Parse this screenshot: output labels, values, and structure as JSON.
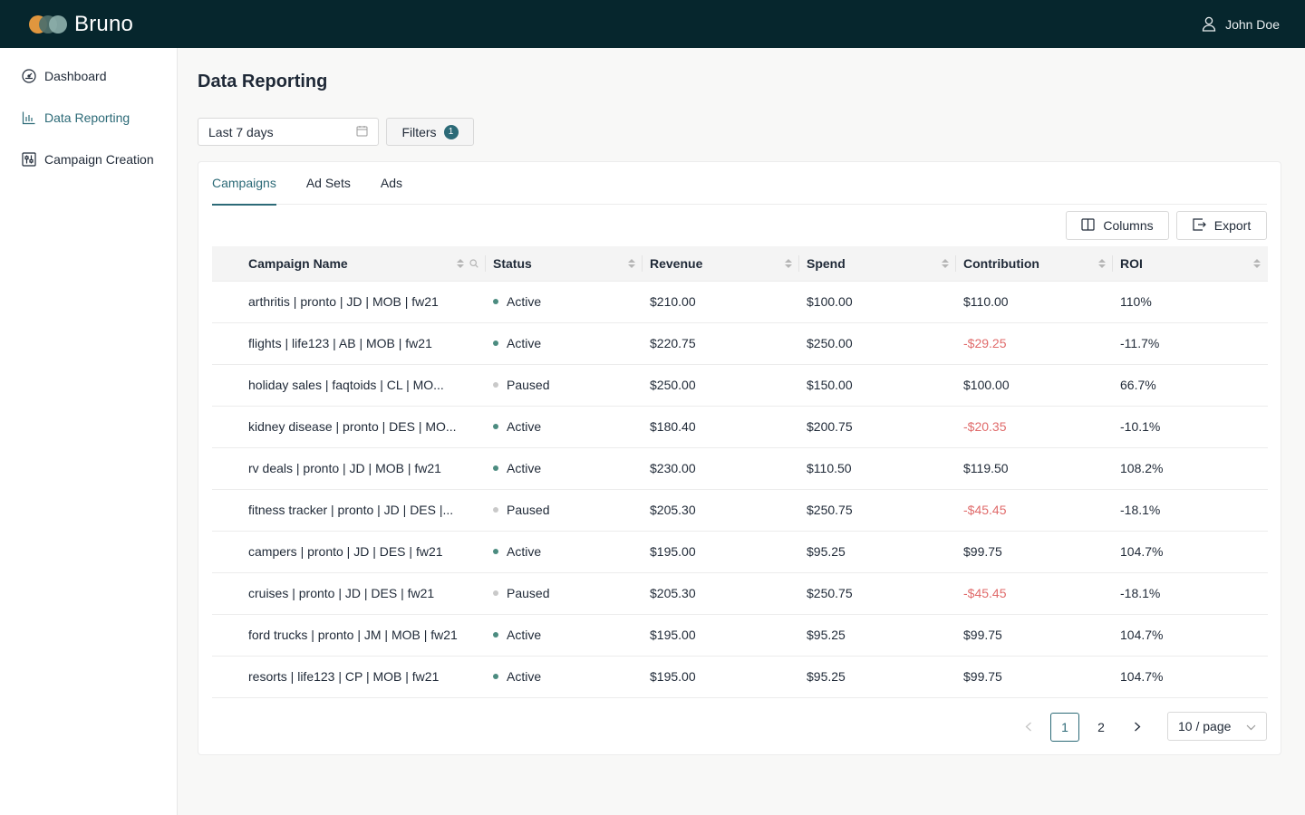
{
  "app": {
    "brand": "Bruno",
    "user_name": "John Doe"
  },
  "sidebar": {
    "items": [
      {
        "label": "Dashboard",
        "icon": "gauge-icon"
      },
      {
        "label": "Data Reporting",
        "icon": "bar-chart-icon",
        "active": true
      },
      {
        "label": "Campaign Creation",
        "icon": "sliders-icon"
      }
    ]
  },
  "page": {
    "title": "Data Reporting"
  },
  "toolbar": {
    "date_range": "Last 7 days",
    "filters_label": "Filters",
    "filters_count": "1",
    "columns_label": "Columns",
    "export_label": "Export"
  },
  "tabs": [
    {
      "label": "Campaigns",
      "active": true
    },
    {
      "label": "Ad Sets"
    },
    {
      "label": "Ads"
    }
  ],
  "table": {
    "headers": [
      "Campaign Name",
      "Status",
      "Revenue",
      "Spend",
      "Contribution",
      "ROI"
    ],
    "rows": [
      {
        "name": "arthritis | pronto | JD | MOB | fw21",
        "status": "Active",
        "revenue": "$210.00",
        "spend": "$100.00",
        "contribution": "$110.00",
        "roi": "110%"
      },
      {
        "name": "flights | life123 | AB | MOB | fw21",
        "status": "Active",
        "revenue": "$220.75",
        "spend": "$250.00",
        "contribution": "-$29.25",
        "roi": "-11.7%"
      },
      {
        "name": "holiday sales | faqtoids | CL | MO...",
        "status": "Paused",
        "revenue": "$250.00",
        "spend": "$150.00",
        "contribution": "$100.00",
        "roi": "66.7%"
      },
      {
        "name": "kidney disease | pronto | DES | MO...",
        "status": "Active",
        "revenue": "$180.40",
        "spend": "$200.75",
        "contribution": "-$20.35",
        "roi": "-10.1%"
      },
      {
        "name": "rv deals | pronto | JD | MOB | fw21",
        "status": "Active",
        "revenue": "$230.00",
        "spend": "$110.50",
        "contribution": "$119.50",
        "roi": "108.2%"
      },
      {
        "name": "fitness tracker | pronto | JD | DES |...",
        "status": "Paused",
        "revenue": "$205.30",
        "spend": "$250.75",
        "contribution": "-$45.45",
        "roi": "-18.1%"
      },
      {
        "name": "campers | pronto | JD | DES | fw21",
        "status": "Active",
        "revenue": "$195.00",
        "spend": "$95.25",
        "contribution": "$99.75",
        "roi": "104.7%"
      },
      {
        "name": "cruises | pronto | JD | DES | fw21",
        "status": "Paused",
        "revenue": "$205.30",
        "spend": "$250.75",
        "contribution": "-$45.45",
        "roi": "-18.1%"
      },
      {
        "name": "ford trucks | pronto | JM | MOB | fw21",
        "status": "Active",
        "revenue": "$195.00",
        "spend": "$95.25",
        "contribution": "$99.75",
        "roi": "104.7%"
      },
      {
        "name": "resorts | life123 | CP | MOB | fw21",
        "status": "Active",
        "revenue": "$195.00",
        "spend": "$95.25",
        "contribution": "$99.75",
        "roi": "104.7%"
      }
    ]
  },
  "pagination": {
    "pages": [
      "1",
      "2"
    ],
    "current": "1",
    "page_size": "10 / page"
  },
  "colors": {
    "accent": "#2c6a77",
    "topbar": "#06262d",
    "negative": "#e06b6b",
    "active_dot": "#4c8c80",
    "paused_dot": "#c9c9c9"
  }
}
